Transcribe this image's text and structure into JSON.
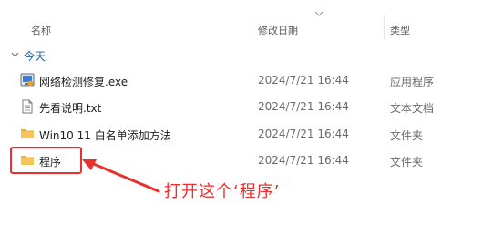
{
  "columns": {
    "name": "名称",
    "date": "修改日期",
    "type": "类型"
  },
  "group": {
    "label": "今天"
  },
  "files": [
    {
      "name": "网络检测修复.exe",
      "date": "2024/7/21 16:44",
      "type": "应用程序",
      "icon": "exe-app-icon"
    },
    {
      "name": "先看说明.txt",
      "date": "2024/7/21 16:44",
      "type": "文本文档",
      "icon": "text-file-icon"
    },
    {
      "name": "Win10 11 白名单添加方法",
      "date": "2024/7/21 16:44",
      "type": "文件夹",
      "icon": "folder-icon"
    },
    {
      "name": "程序",
      "date": "2024/7/21 16:44",
      "type": "文件夹",
      "icon": "folder-icon"
    }
  ],
  "annotation": {
    "text": "打开这个‘程序’"
  },
  "colors": {
    "accent": "#e8312f",
    "folder": "#f4c65a",
    "group": "#1f5fa8"
  }
}
